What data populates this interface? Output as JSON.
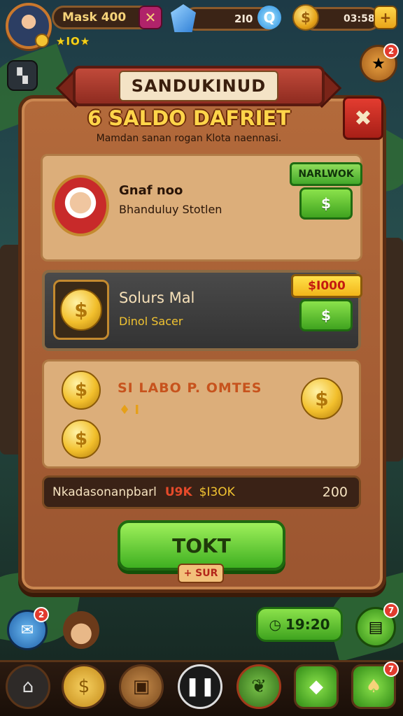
{
  "hud": {
    "player_name": "Mask 400",
    "stars": "★IO★",
    "gems_value": "2I0",
    "coins_value": "03:58",
    "name_plus": "✕",
    "gems_plus": "Q",
    "coins_plus": "+"
  },
  "header": {
    "ribbon_title": "SANDUKINUD",
    "panel_title": "6 SALDO DAFRIET",
    "panel_subtitle": "Mamdan sanan rogan Klota naennasi."
  },
  "card1": {
    "title": "Gnaf noo",
    "subtitle": "Bhanduluy Stotlen",
    "tag": "NARLWOK",
    "button": "$"
  },
  "card2": {
    "title": "Solurs Mal",
    "subtitle": "Dinol Sacer",
    "tag": "$I000",
    "button": "$"
  },
  "card3": {
    "title": "SI LABO P. OMTES",
    "icon_row": "♦   I"
  },
  "status_bar": {
    "left_text": "Nkadasonanpbarl",
    "mid_text": "U9K",
    "price_text": "$I3OK",
    "right_value": "200"
  },
  "main_button": {
    "label": "TOKT",
    "tag": "+ SUR"
  },
  "footer": {
    "timer": "19:20",
    "notif_count_chat": "2",
    "notif_count_top": "2",
    "notif_count_right": "7",
    "notif_count_nav": "7"
  },
  "colors": {
    "panel": "#b36a3b",
    "accent_green": "#3fa31f",
    "accent_gold": "#f2bf2c",
    "ribbon_red": "#c14a3a"
  }
}
